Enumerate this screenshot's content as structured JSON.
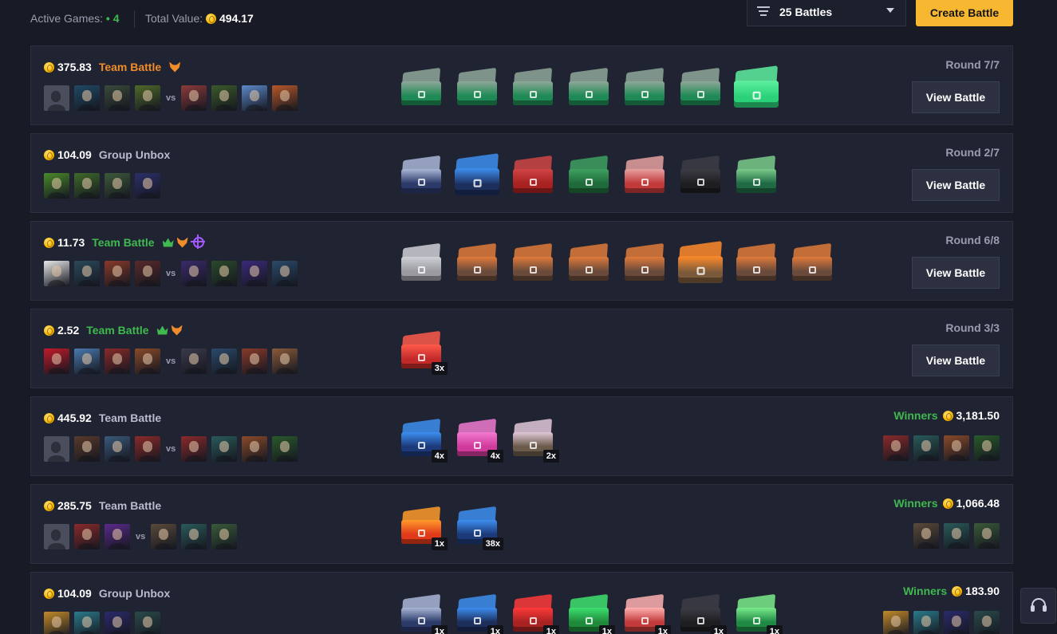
{
  "header": {
    "active_games_label": "Active Games:",
    "active_games_count": "4",
    "total_value_label": "Total Value:",
    "total_value": "494.17",
    "filter_label": "25 Battles",
    "create_button": "Create Battle"
  },
  "labels": {
    "vs": "vs",
    "view_battle": "View Battle",
    "winners": "Winners"
  },
  "battles": [
    {
      "value": "375.83",
      "mode": "Team Battle",
      "mode_color": "orange",
      "badges": [
        "fox-icon"
      ],
      "round": "Round 7/7",
      "team_a": [
        "#5a5d6b",
        "#1f4a66",
        "#3a4a3a",
        "#4f6a2a"
      ],
      "team_b": [
        "#8c3a3a",
        "#3b5a2a",
        "#5b89c9",
        "#b8582a"
      ],
      "cases": [
        {
          "color": "#1f8a55",
          "lid": "#8fa89a"
        },
        {
          "color": "#1f8a55",
          "lid": "#8fa89a"
        },
        {
          "color": "#1f8a55",
          "lid": "#8fa89a"
        },
        {
          "color": "#1f8a55",
          "lid": "#8fa89a"
        },
        {
          "color": "#1f8a55",
          "lid": "#8fa89a"
        },
        {
          "color": "#1f8a55",
          "lid": "#8fa89a"
        },
        {
          "color": "#2bd179",
          "lid": "#5ef0a0",
          "big": true
        }
      ]
    },
    {
      "value": "104.09",
      "mode": "Group Unbox",
      "mode_color": "gray",
      "badges": [],
      "round": "Round 2/7",
      "team_a": [
        "#4a8a2a",
        "#3f6a2a",
        "#3d5a3a",
        "#2c2f6a"
      ],
      "team_b": [],
      "cases": [
        {
          "color": "#2c3a6a",
          "lid": "#a9b6d6"
        },
        {
          "color": "#1c2e5c",
          "lid": "#3d8ef0",
          "big": true
        },
        {
          "color": "#a82222",
          "lid": "#d04545"
        },
        {
          "color": "#1f6a3a",
          "lid": "#3ea060"
        },
        {
          "color": "#c23a3a",
          "lid": "#e6a0a0"
        },
        {
          "color": "#1e1e22",
          "lid": "#3c3c44"
        },
        {
          "color": "#1f6a44",
          "lid": "#7acb8a"
        }
      ]
    },
    {
      "value": "11.73",
      "mode": "Team Battle",
      "mode_color": "green",
      "badges": [
        "crown-icon",
        "fox-icon",
        "target-icon"
      ],
      "round": "Round 6/8",
      "team_a": [
        "#e8e8e8",
        "#2a4a5a",
        "#8a3a2a",
        "#5a2a2a"
      ],
      "team_b": [
        "#3a2a6a",
        "#2a4a2a",
        "#3a2a7a",
        "#2a4a6a"
      ],
      "cases": [
        {
          "color": "#9a9aa0",
          "lid": "#cfcfd6"
        },
        {
          "color": "#6a4a3a",
          "lid": "#e07a3a"
        },
        {
          "color": "#6a4a3a",
          "lid": "#e07a3a"
        },
        {
          "color": "#6a4a3a",
          "lid": "#e07a3a"
        },
        {
          "color": "#6a4a3a",
          "lid": "#e07a3a"
        },
        {
          "color": "#7a5a3a",
          "lid": "#ff8a2a",
          "big": true
        },
        {
          "color": "#6a4a3a",
          "lid": "#e07a3a"
        },
        {
          "color": "#6a4a3a",
          "lid": "#e07a3a"
        }
      ]
    },
    {
      "value": "2.52",
      "mode": "Team Battle",
      "mode_color": "green",
      "badges": [
        "crown-icon",
        "fox-icon"
      ],
      "round": "Round 3/3",
      "team_a": [
        "#c21a2a",
        "#4a7ab0",
        "#8a2a2a",
        "#8a4a2a"
      ],
      "team_b": [
        "#3a3a4a",
        "#2a4a6a",
        "#8a3a2a",
        "#8a5a3a"
      ],
      "cases": [
        {
          "color": "#c22a2a",
          "lid": "#ff5a4a",
          "mult": "3x"
        }
      ]
    },
    {
      "value": "445.92",
      "mode": "Team Battle",
      "mode_color": "gray",
      "badges": [],
      "winners_amount": "3,181.50",
      "team_a": [
        "#5a5d6b",
        "#5a3a2a",
        "#3a5a7a",
        "#8a2a2a"
      ],
      "team_b": [
        "#8a2a2a",
        "#2a5a5a",
        "#8a4a2a",
        "#2a5a2a"
      ],
      "winners": [
        "#8a2a2a",
        "#2a5a5a",
        "#8a4a2a",
        "#2a5a2a"
      ],
      "cases": [
        {
          "color": "#1c3a7a",
          "lid": "#3d8ef0",
          "mult": "4x"
        },
        {
          "color": "#d03a9a",
          "lid": "#f07ad0",
          "mult": "4x"
        },
        {
          "color": "#6a5a4a",
          "lid": "#e0c8d8",
          "mult": "2x"
        }
      ]
    },
    {
      "value": "285.75",
      "mode": "Team Battle",
      "mode_color": "gray",
      "badges": [],
      "winners_amount": "1,066.48",
      "team_a": [
        "#5a5d6b",
        "#8a2a2a",
        "#5a2a8a"
      ],
      "team_b": [
        "#5a4a3a",
        "#2a5a5a",
        "#3a5a3a"
      ],
      "winners": [
        "#5a4a3a",
        "#2a5a5a",
        "#3a5a3a"
      ],
      "cases": [
        {
          "color": "#e03a1a",
          "lid": "#ff9a2a",
          "mult": "1x"
        },
        {
          "color": "#1c3a7a",
          "lid": "#3d8ef0",
          "mult": "38x"
        }
      ]
    },
    {
      "value": "104.09",
      "mode": "Group Unbox",
      "mode_color": "gray",
      "badges": [],
      "winners_amount": "183.90",
      "team_a": [
        "#c28a2a",
        "#2a7a8a",
        "#2a2a6a",
        "#2a4a4a"
      ],
      "team_b": [],
      "winners": [
        "#c28a2a",
        "#2a7a8a",
        "#2a2a6a",
        "#2a4a4a"
      ],
      "cases": [
        {
          "color": "#2c3a6a",
          "lid": "#a9b6d6",
          "mult": "1x"
        },
        {
          "color": "#1c2e5c",
          "lid": "#3d8ef0",
          "mult": "1x"
        },
        {
          "color": "#a82222",
          "lid": "#ff3a3a",
          "mult": "1x"
        },
        {
          "color": "#1f8a3a",
          "lid": "#3ee070",
          "mult": "1x"
        },
        {
          "color": "#c23a3a",
          "lid": "#ffb0b0",
          "mult": "1x"
        },
        {
          "color": "#1e1e22",
          "lid": "#3c3c44",
          "mult": "1x"
        },
        {
          "color": "#1f8a44",
          "lid": "#7aeb8a",
          "mult": "1x"
        }
      ]
    }
  ]
}
